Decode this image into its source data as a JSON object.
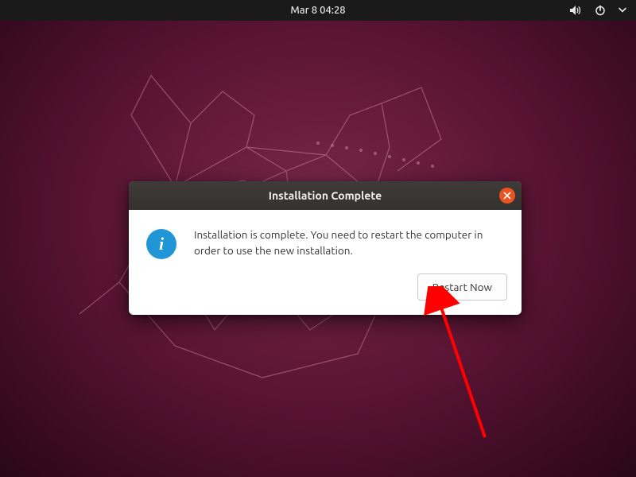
{
  "topbar": {
    "datetime": "Mar 8  04:28"
  },
  "dialog": {
    "title": "Installation Complete",
    "message": "Installation is complete. You need to restart the computer in order to use the new installation.",
    "restart_label": "Restart Now"
  },
  "icons": {
    "info_letter": "i"
  }
}
